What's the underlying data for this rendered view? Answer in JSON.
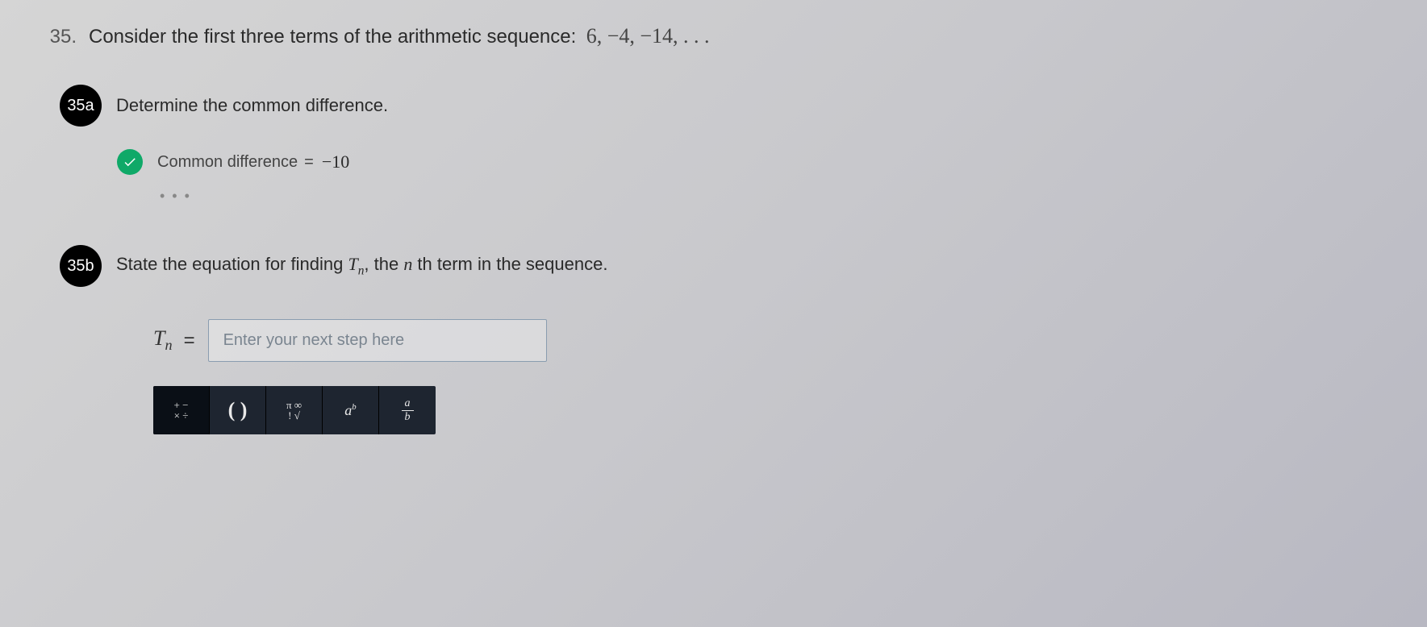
{
  "question": {
    "number": "35.",
    "prompt": "Consider the first three terms of the arithmetic sequence:",
    "sequence": "6, −4, −14, . . ."
  },
  "partA": {
    "badge": "35a",
    "prompt": "Determine the common difference.",
    "answer_label": "Common difference",
    "equals": "=",
    "answer_value": "−10",
    "more_dots": "• • •"
  },
  "partB": {
    "badge": "35b",
    "prompt_prefix": "State the equation for finding ",
    "variable": "T",
    "subscript": "n",
    "prompt_mid": ", the ",
    "nth": "n",
    "prompt_suffix": " th term in the sequence.",
    "input_var": "T",
    "input_sub": "n",
    "input_eq": "=",
    "placeholder": "Enter your next step here"
  },
  "toolbar": {
    "ops_top": "+ −",
    "ops_bot": "× ÷",
    "parens": "( )",
    "pi_inf": "π ∞",
    "fact_root": "! √",
    "exp_base": "a",
    "exp_sup": "b",
    "frac_num": "a",
    "frac_den": "b"
  }
}
